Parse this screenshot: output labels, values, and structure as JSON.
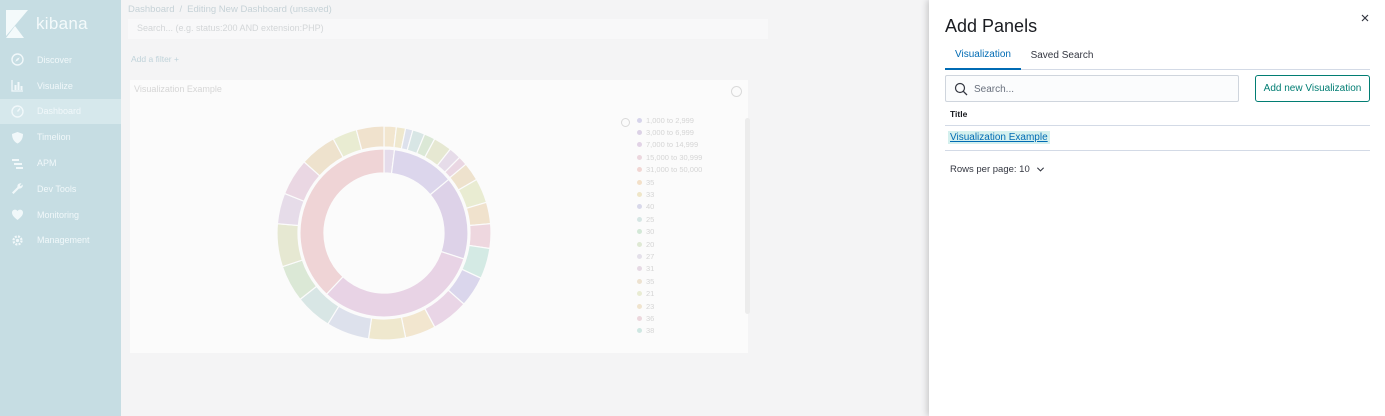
{
  "app": {
    "name": "kibana"
  },
  "sidebar": {
    "items": [
      {
        "label": "Discover",
        "icon": "compass-icon"
      },
      {
        "label": "Visualize",
        "icon": "bar-chart-icon"
      },
      {
        "label": "Dashboard",
        "icon": "dashboard-icon",
        "active": true
      },
      {
        "label": "Timelion",
        "icon": "shield-icon"
      },
      {
        "label": "APM",
        "icon": "apm-icon"
      },
      {
        "label": "Dev Tools",
        "icon": "wrench-icon"
      },
      {
        "label": "Monitoring",
        "icon": "heartbeat-icon"
      },
      {
        "label": "Management",
        "icon": "gear-icon"
      }
    ]
  },
  "main": {
    "breadcrumb": {
      "root": "Dashboard",
      "separator": "/",
      "current": "Editing New Dashboard (unsaved)"
    },
    "query_placeholder": "Search... (e.g. status:200 AND extension:PHP)",
    "add_filter": "Add a filter +",
    "panel_title": "Visualization Example",
    "legend": [
      {
        "label": "1,000 to 2,999",
        "color": "#d7d5eb"
      },
      {
        "label": "3,000 to 6,999",
        "color": "#dcd2e6"
      },
      {
        "label": "7,000 to 14,999",
        "color": "#e2d3e6"
      },
      {
        "label": "15,000 to 30,999",
        "color": "#ecd7de"
      },
      {
        "label": "31,000 to 50,000",
        "color": "#f1d6d3"
      },
      {
        "label": "35",
        "color": "#f3e0c8"
      },
      {
        "label": "33",
        "color": "#efe6c8"
      },
      {
        "label": "40",
        "color": "#d8d8ea"
      },
      {
        "label": "25",
        "color": "#d6e6e4"
      },
      {
        "label": "30",
        "color": "#d3e8d7"
      },
      {
        "label": "20",
        "color": "#dfe9d4"
      },
      {
        "label": "27",
        "color": "#e4e0ea"
      },
      {
        "label": "31",
        "color": "#e6d9e4"
      },
      {
        "label": "35",
        "color": "#ede2d0"
      },
      {
        "label": "21",
        "color": "#e9ecd3"
      },
      {
        "label": "23",
        "color": "#f0e4ce"
      },
      {
        "label": "36",
        "color": "#ecd7dd"
      },
      {
        "label": "38",
        "color": "#cfe7e2"
      }
    ]
  },
  "flyout": {
    "title": "Add Panels",
    "tabs": [
      {
        "label": "Visualization",
        "selected": true
      },
      {
        "label": "Saved Search",
        "selected": false
      }
    ],
    "search_placeholder": "Search...",
    "add_button": "Add new Visualization",
    "table": {
      "column": "Title",
      "rows": [
        "Visualization Example"
      ]
    },
    "rows_per_page": "Rows per page: 10"
  },
  "colors": {
    "accent": "#006bb4",
    "button": "#017d73",
    "sidebar": "#c6dde3"
  }
}
